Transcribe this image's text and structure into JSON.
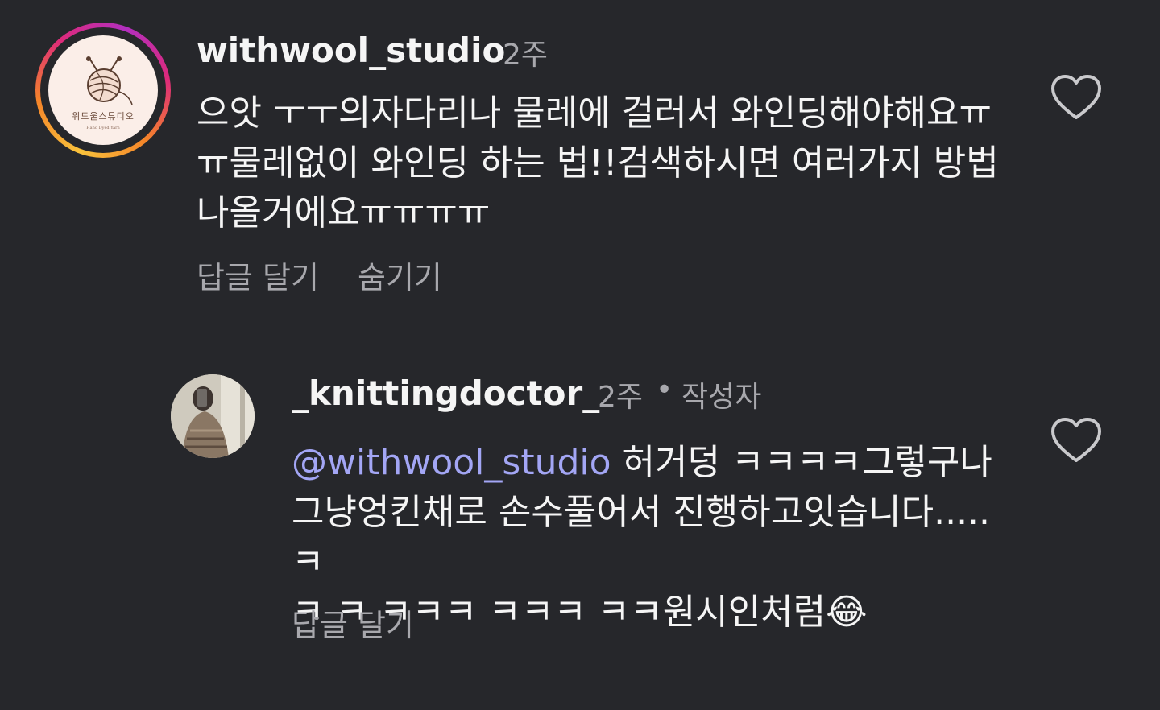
{
  "comments": [
    {
      "username": "withwool_studio",
      "time": "2주",
      "avatar": {
        "caption": "위드울스튜디오",
        "sub": "Hand Dyed Yarn"
      },
      "lines": [
        "으앗 ㅜㅜ의자다리나 물레에 걸러서 와인딩해야해요ㅠ",
        "ㅠ물레없이 와인딩 하는 법!!검색하시면 여러가지 방법",
        "나올거에요ㅠㅠㅠㅠ"
      ],
      "actions": {
        "reply": "답글 달기",
        "hide": "숨기기"
      },
      "like_icon": "heart-outline-icon"
    },
    {
      "username": "_knittingdoctor_",
      "time": "2주",
      "separator": "•",
      "author_badge": "작성자",
      "mention": "@withwool_studio",
      "line1_rest": " 허거덩 ㅋㅋㅋㅋ그렇구나",
      "line2": "그냥엉킨채로 손수풀어서 진행하고잇습니다..... ㅋ",
      "line3": "ㅋ ㅋ ㅋㅋㅋ ㅋㅋㅋ ㅋㅋ원시인처럼",
      "emoji": "😂",
      "actions": {
        "reply": "답글 달기"
      },
      "like_icon": "heart-outline-icon"
    }
  ],
  "colors": {
    "background": "#26272b",
    "text_primary": "#f5f5f5",
    "text_secondary": "#a8a8ad",
    "mention": "#a3a6f5",
    "story_ring": [
      "#f9c23c",
      "#f58529",
      "#dd2a7b",
      "#b22fbf"
    ]
  }
}
